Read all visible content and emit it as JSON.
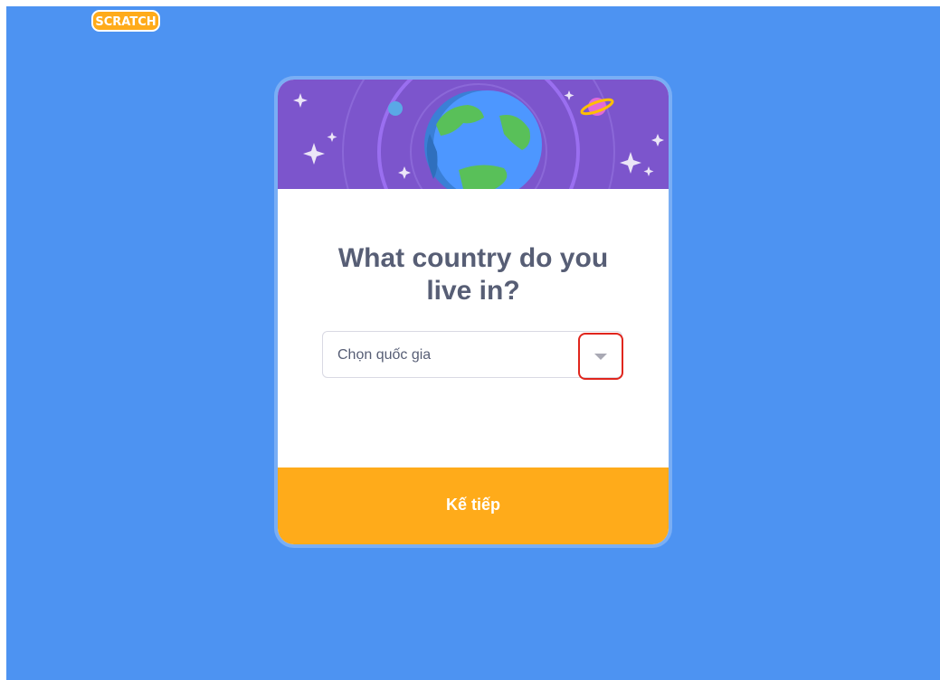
{
  "logo": {
    "text": "SCRATCH"
  },
  "question": {
    "title": "What country do you live in?"
  },
  "country_select": {
    "placeholder": "Chọn quốc gia",
    "icon": "chevron-down-icon"
  },
  "footer": {
    "next_label": "Kế tiếp"
  },
  "colors": {
    "background": "#4d93f2",
    "header": "#7c55cc",
    "next_button": "#ffab1a",
    "title_text": "#575e75",
    "highlight": "#e0261d"
  }
}
